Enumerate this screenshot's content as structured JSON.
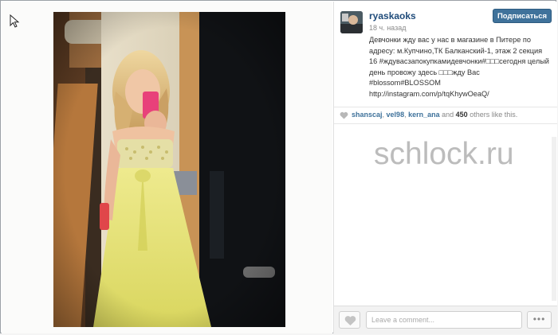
{
  "post": {
    "username": "ryaskaoks",
    "timestamp": "18 ч. назад",
    "subscribe_label": "Подписаться",
    "caption": "Девчонки жду вас у нас в магазине в Питере по адресу: м.Купчино,ТК Балканский-1, этаж 2 секция 16 #ждувасзапокупкамидевчонки#□□□сегодня целый день провожу здесь □□□жду Вас #blossom#BLOSSOM http://instagram.com/p/tqKhywOeaQ/"
  },
  "likes": {
    "users": [
      "shanscaj",
      "vel98",
      "kern_ana"
    ],
    "sep1": ", ",
    "sep2": ", ",
    "and_text": " and ",
    "others_count": "450",
    "others_text": " others like this."
  },
  "comment": {
    "placeholder": "Leave a comment..."
  },
  "more_label": "•••",
  "watermark": "schlock.ru",
  "icons": {
    "like": "heart-icon",
    "more": "more-dots-icon",
    "cursor": "mouse-cursor-icon"
  },
  "colors": {
    "accent": "#3f729b",
    "username": "#1f4b7a"
  }
}
